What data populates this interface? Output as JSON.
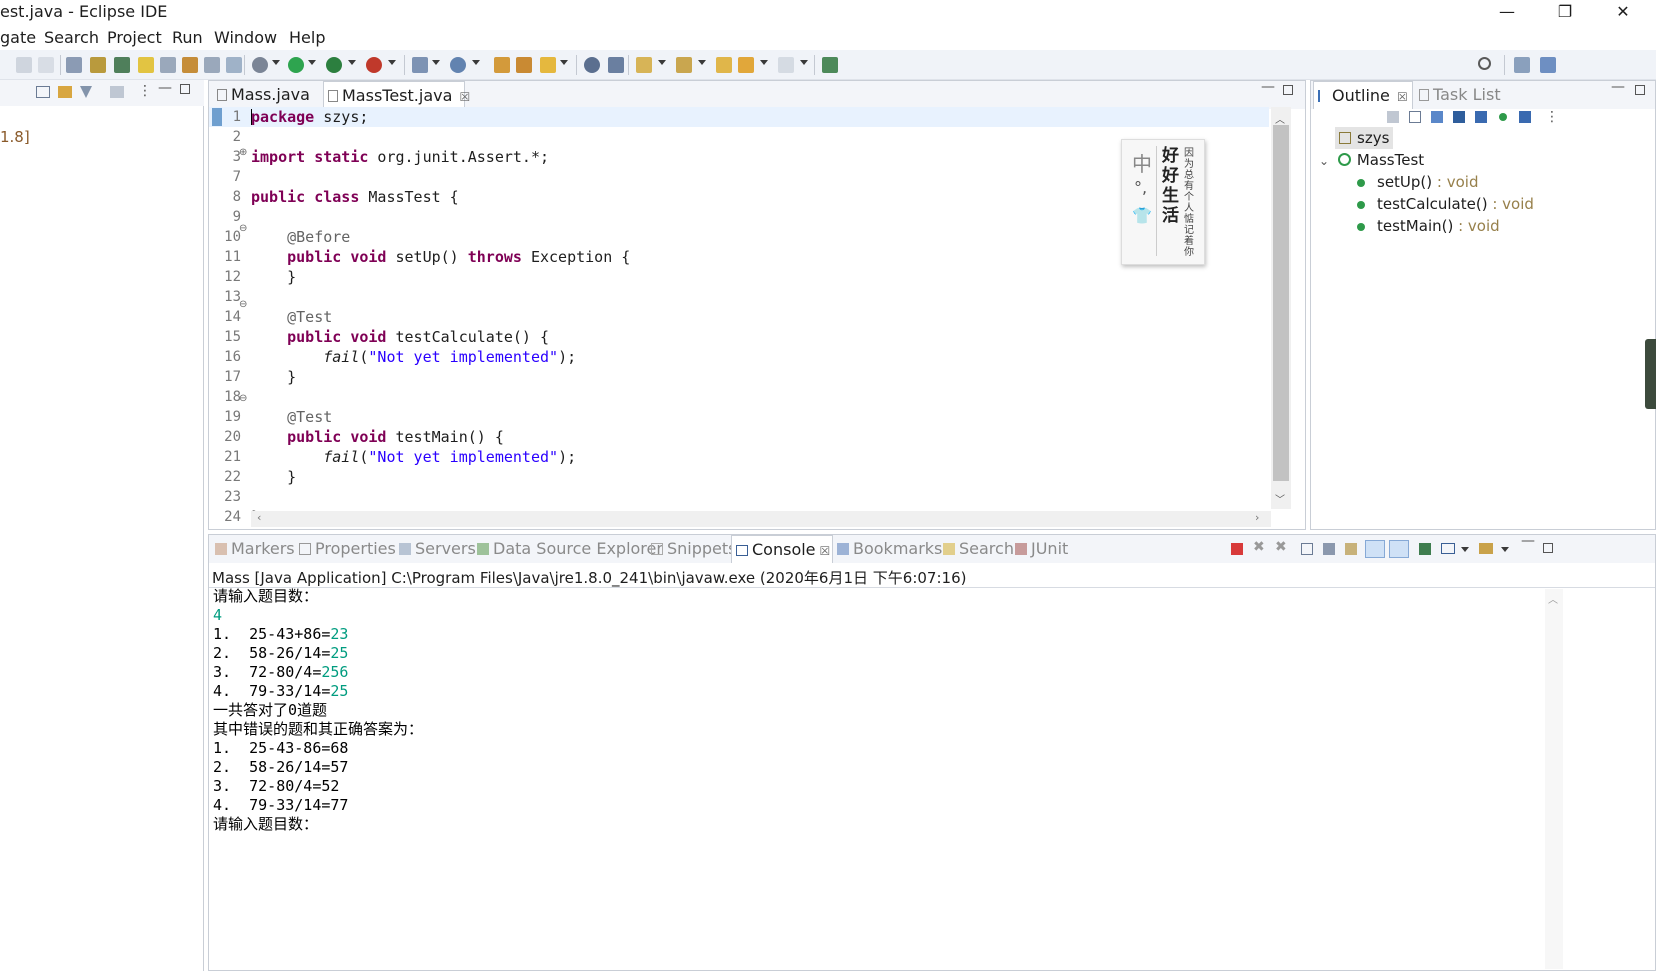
{
  "window": {
    "title": "est.java - Eclipse IDE",
    "min": "—",
    "restore": "❐",
    "close": "✕"
  },
  "menu": [
    "gate",
    "Search",
    "Project",
    "Run",
    "Window",
    "Help"
  ],
  "left_panel": {
    "fragment": "1.8]"
  },
  "editor": {
    "tabs": [
      {
        "label": "Mass.java",
        "active": false
      },
      {
        "label": "MassTest.java",
        "active": true,
        "close": "☒"
      }
    ],
    "line_numbers": [
      "1",
      "2",
      "3",
      "7",
      "8",
      "9",
      "10",
      "11",
      "12",
      "13",
      "14",
      "15",
      "16",
      "17",
      "18",
      "19",
      "20",
      "21",
      "22",
      "23",
      "24"
    ],
    "fold_marks": {
      "3": "⊕",
      "10": "⊖",
      "14": "⊖",
      "19": "⊖"
    },
    "code": {
      "l1_kw": "package",
      "l1_rest": " szys;",
      "l3_kw1": "import",
      "l3_kw2": " static",
      "l3_rest": " org.junit.Assert.*;",
      "l8_kw1": "public",
      "l8_kw2": " class",
      "l8_rest": " MassTest {",
      "l10_ann": "    @Before",
      "l11_kw1": "    public",
      "l11_kw2": " void",
      "l11_mid": " setUp() ",
      "l11_kw3": "throws",
      "l11_rest": " Exception {",
      "l12": "    }",
      "l14_ann": "    @Test",
      "l15_kw1": "    public",
      "l15_kw2": " void",
      "l15_rest": " testCalculate() {",
      "l16_pre": "        ",
      "l16_fn": "fail",
      "l16_open": "(",
      "l16_str": "\"Not yet implemented\"",
      "l16_close": ");",
      "l17": "    }",
      "l19_ann": "    @Test",
      "l20_kw1": "    public",
      "l20_kw2": " void",
      "l20_rest": " testMain() {",
      "l21_pre": "        ",
      "l21_fn": "fail",
      "l21_open": "(",
      "l21_str": "\"Not yet implemented\"",
      "l21_close": ");",
      "l22": "    }",
      "l24": "}"
    },
    "ime_widget": {
      "left_char": "中",
      "punct": "°,",
      "shirt": "👕",
      "title": "好好生活",
      "vertical": "因为总有个人惦记着你"
    }
  },
  "outline": {
    "tabs": [
      {
        "label": "Outline",
        "close": "☒"
      },
      {
        "label": "Task List"
      }
    ],
    "package": "szys",
    "class_name": "MassTest",
    "methods": [
      {
        "name": "setUp()",
        "type": " : void"
      },
      {
        "name": "testCalculate()",
        "type": " : void"
      },
      {
        "name": "testMain()",
        "type": " : void"
      }
    ]
  },
  "bottom": {
    "tabs": [
      "Markers",
      "Properties",
      "Servers",
      "Data Source Explorer",
      "Snippets",
      "Console",
      "Bookmarks",
      "Search",
      "JUnit"
    ],
    "console_close": "☒"
  },
  "console": {
    "header": "Mass [Java Application] C:\\Program Files\\Java\\jre1.8.0_241\\bin\\javaw.exe (2020年6月1日 下午6:07:16)",
    "lines": [
      {
        "text": "请输入题目数：",
        "input": ""
      },
      {
        "text": "",
        "input": "4"
      },
      {
        "text": "1.  25-43+86=",
        "input": "23"
      },
      {
        "text": "2.  58-26/14=",
        "input": "25"
      },
      {
        "text": "3.  72-80/4=",
        "input": "256"
      },
      {
        "text": "4.  79-33/14=",
        "input": "25"
      },
      {
        "text": "一共答对了0道题",
        "input": ""
      },
      {
        "text": "其中错误的题和其正确答案为：",
        "input": ""
      },
      {
        "text": "1.  25-43-86=68",
        "input": ""
      },
      {
        "text": "2.  58-26/14=57",
        "input": ""
      },
      {
        "text": "3.  72-80/4=52",
        "input": ""
      },
      {
        "text": "4.  79-33/14=77",
        "input": ""
      },
      {
        "text": "请输入题目数：",
        "input": ""
      }
    ]
  }
}
